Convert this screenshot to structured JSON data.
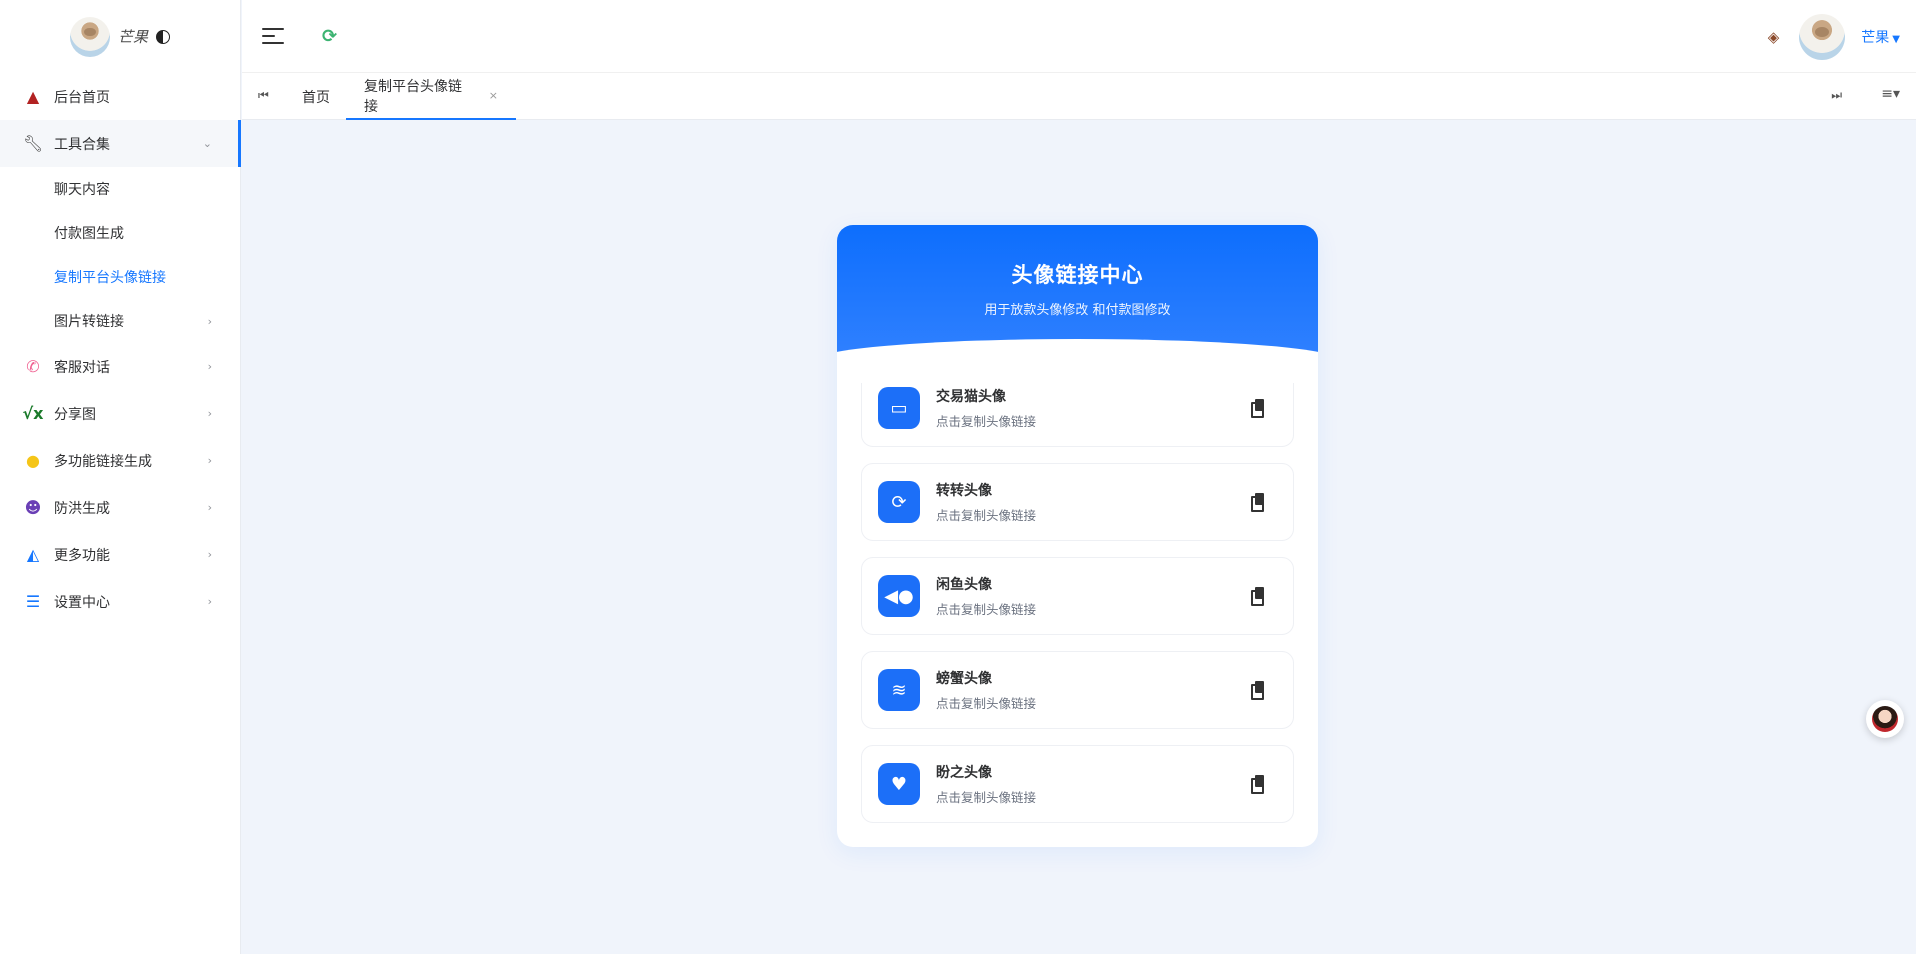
{
  "brand": {
    "name": "芒果"
  },
  "sidebar": {
    "items": [
      {
        "label": "后台首页",
        "icon": "home-icon"
      },
      {
        "label": "工具合集",
        "icon": "wrench-icon",
        "open": true,
        "children": [
          {
            "label": "聊天内容"
          },
          {
            "label": "付款图生成"
          },
          {
            "label": "复制平台头像链接",
            "active": true
          },
          {
            "label": "图片转链接",
            "chevron": true
          }
        ]
      },
      {
        "label": "客服对话",
        "icon": "phone-icon"
      },
      {
        "label": "分享图",
        "icon": "sqrt-icon"
      },
      {
        "label": "多功能链接生成",
        "icon": "coins-icon"
      },
      {
        "label": "防洪生成",
        "icon": "mask-icon"
      },
      {
        "label": "更多功能",
        "icon": "app-icon"
      },
      {
        "label": "设置中心",
        "icon": "list-icon"
      }
    ]
  },
  "header": {
    "user_name": "芒果"
  },
  "tabs": [
    {
      "label": "首页"
    },
    {
      "label": "复制平台头像链接",
      "active": true
    }
  ],
  "card": {
    "title": "头像链接中心",
    "subtitle": "用于放款头像修改 和付款图修改",
    "rows": [
      {
        "title": "交易猫头像",
        "desc": "点击复制头像链接",
        "icon": "store-icon"
      },
      {
        "title": "转转头像",
        "desc": "点击复制头像链接",
        "icon": "sync-icon"
      },
      {
        "title": "闲鱼头像",
        "desc": "点击复制头像链接",
        "icon": "fish-icon"
      },
      {
        "title": "螃蟹头像",
        "desc": "点击复制头像链接",
        "icon": "water-icon"
      },
      {
        "title": "盼之头像",
        "desc": "点击复制头像链接",
        "icon": "heart-icon"
      }
    ]
  },
  "colors": {
    "accent": "#1677ff",
    "card_head": "#0d6efd",
    "bg": "#f0f4fb"
  }
}
